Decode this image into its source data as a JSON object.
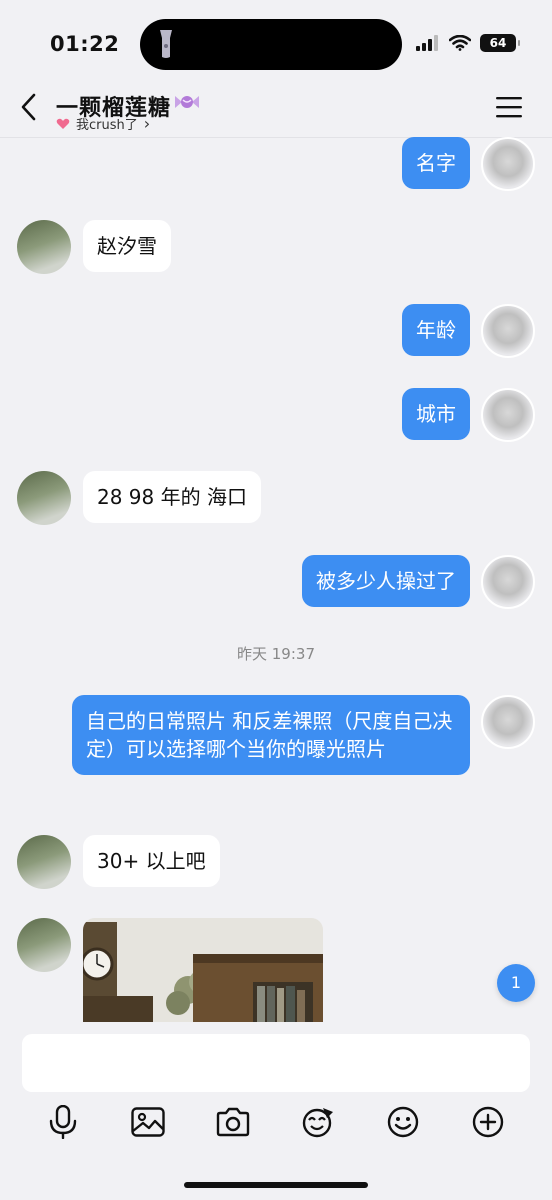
{
  "status_bar": {
    "time": "01:22",
    "battery": "64"
  },
  "header": {
    "title": "一颗榴莲糖",
    "subtitle": "我crush了",
    "subtitle_chevron": "›"
  },
  "icons": {
    "back": "back-chevron-icon",
    "menu": "hamburger-menu-icon",
    "candy": "candy-icon",
    "heart": "heart-icon",
    "voice": "microphone-icon",
    "gallery": "image-icon",
    "camera": "camera-icon",
    "sticker": "sticker-icon",
    "emoji": "smiley-icon",
    "more": "plus-circle-icon"
  },
  "colors": {
    "bubble_me": "#3d8ef2",
    "bubble_her": "#ffffff",
    "background": "#f1f1f4"
  },
  "messages": [
    {
      "sender": "me",
      "text": "名字"
    },
    {
      "sender": "her",
      "text": "赵汐雪"
    },
    {
      "sender": "me",
      "text": "年龄"
    },
    {
      "sender": "me",
      "text": "城市"
    },
    {
      "sender": "her",
      "text": "28 98 年的 海口"
    },
    {
      "sender": "me",
      "text": "被多少人操过了"
    },
    {
      "sender": "me",
      "text": "自己的日常照片 和反差裸照（尺度自己决定）可以选择哪个当你的曝光照片"
    },
    {
      "sender": "her",
      "text": "30+ 以上吧"
    },
    {
      "sender": "her",
      "type": "image"
    }
  ],
  "timestamp": "昨天 19:37",
  "unread_count": "1",
  "input": {
    "placeholder": ""
  }
}
